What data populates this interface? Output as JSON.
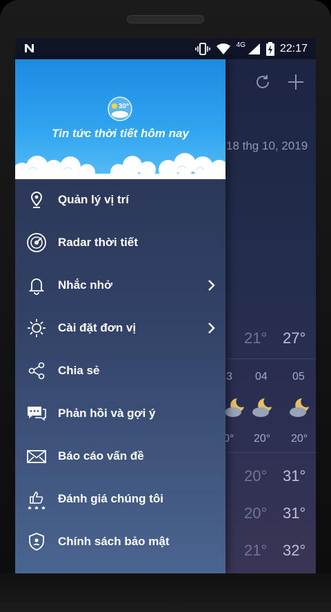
{
  "status": {
    "carrier_icon": "n-notification-icon",
    "network": "4G",
    "time": "22:17"
  },
  "background_app": {
    "date": "18 thg 10, 2019",
    "row_top": {
      "lo": "21°",
      "hi": "27°"
    },
    "hours": [
      "3",
      "04",
      "05"
    ],
    "hour_temps": [
      "0°",
      "20°",
      "20°"
    ],
    "daily": [
      {
        "lo": "20°",
        "hi": "31°"
      },
      {
        "lo": "20°",
        "hi": "31°"
      },
      {
        "lo": "21°",
        "hi": "32°"
      }
    ]
  },
  "drawer": {
    "logo_temp": "30°",
    "title": "Tin tức thời tiết hôm nay",
    "items": [
      {
        "label": "Quản lý vị trí",
        "icon": "location-pin-icon"
      },
      {
        "label": "Radar thời tiết",
        "icon": "radar-icon"
      },
      {
        "label": "Nhắc nhở",
        "icon": "bell-icon",
        "chevron": true
      },
      {
        "label": "Cài đặt đơn vị",
        "icon": "sun-settings-icon",
        "chevron": true
      },
      {
        "label": "Chia sẻ",
        "icon": "share-icon"
      },
      {
        "label": "Phản hồi và gợi ý",
        "icon": "chat-bubble-icon"
      },
      {
        "label": "Báo cáo vấn đề",
        "icon": "envelope-icon"
      },
      {
        "label": "Đánh giá chúng tôi",
        "icon": "thumbs-up-stars-icon"
      },
      {
        "label": "Chính sách bảo mật",
        "icon": "shield-user-icon"
      }
    ]
  }
}
